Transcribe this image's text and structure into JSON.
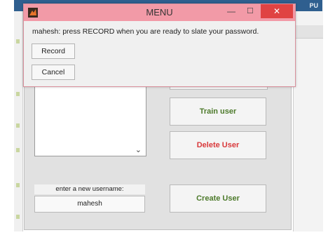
{
  "background": {
    "top_tab": "PU"
  },
  "dialog": {
    "title": "MENU",
    "minimize_glyph": "—",
    "maximize_glyph": "☐",
    "close_glyph": "✕",
    "prompt": "mahesh: press RECORD when you are ready to slate your password.",
    "record_label": "Record",
    "cancel_label": "Cancel",
    "accent": "#f29aa7"
  },
  "gui": {
    "train_label": "Train user",
    "delete_label": "Delete User",
    "create_label": "Create User",
    "new_user_label": "enter a new username:",
    "username_value": "mahesh",
    "train_color": "#4d7a2b",
    "delete_color": "#d9393b"
  }
}
